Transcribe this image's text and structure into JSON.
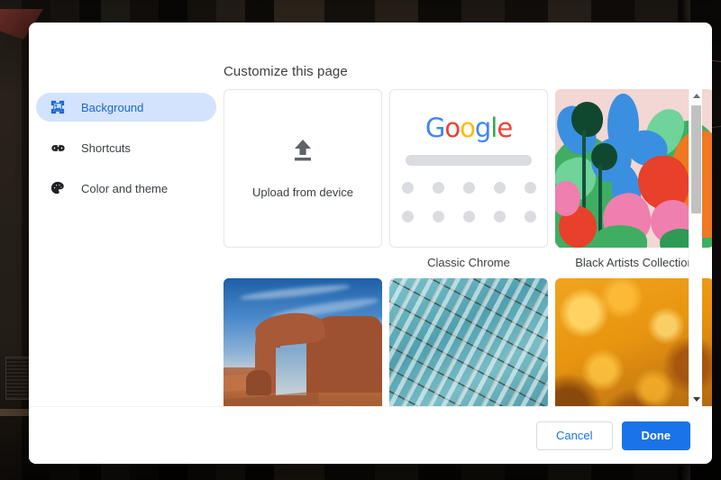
{
  "dialog": {
    "title": "Customize this page",
    "sidebar": {
      "items": [
        {
          "label": "Background",
          "icon": "image-frame-icon",
          "selected": true
        },
        {
          "label": "Shortcuts",
          "icon": "link-chain-icon",
          "selected": false
        },
        {
          "label": "Color and theme",
          "icon": "palette-icon",
          "selected": false
        }
      ]
    },
    "tiles": [
      {
        "id": "upload",
        "type": "upload",
        "label": "Upload from device",
        "caption": "",
        "icon": "upload-arrow-icon"
      },
      {
        "id": "classic-chrome",
        "type": "classic",
        "label": "",
        "caption": "Classic Chrome",
        "logo_text": "Google"
      },
      {
        "id": "black-artists-collection",
        "type": "art",
        "label": "",
        "caption": "Black Artists Collection"
      },
      {
        "id": "delicate-arch",
        "type": "arch",
        "label": "",
        "caption": ""
      },
      {
        "id": "glass-facade",
        "type": "glass",
        "label": "",
        "caption": ""
      },
      {
        "id": "autumn-foliage",
        "type": "autumn",
        "label": "",
        "caption": ""
      }
    ],
    "google_logo": {
      "letters": [
        {
          "char": "G",
          "color": "#4285F4"
        },
        {
          "char": "o",
          "color": "#EA4335"
        },
        {
          "char": "o",
          "color": "#FBBC05"
        },
        {
          "char": "g",
          "color": "#4285F4"
        },
        {
          "char": "l",
          "color": "#34A853"
        },
        {
          "char": "e",
          "color": "#EA4335"
        }
      ]
    },
    "scrollbar": {
      "up_arrow": "scroll-up",
      "down_arrow": "scroll-down",
      "thumb": "scroll-thumb"
    },
    "footer": {
      "cancel_label": "Cancel",
      "done_label": "Done"
    },
    "colors": {
      "accent": "#1a73e8",
      "selected_pill_bg": "#d3e3fd",
      "selected_text": "#1967d2",
      "body_text": "#3c4043",
      "tile_border": "#e4e6e8"
    }
  }
}
